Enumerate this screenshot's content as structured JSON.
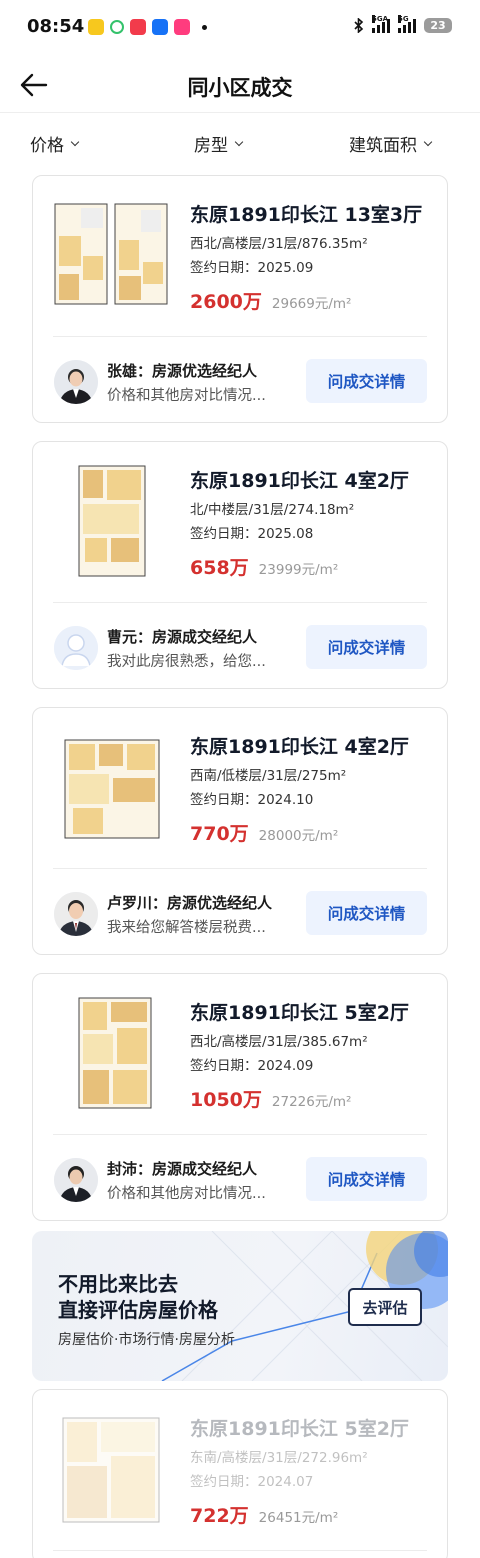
{
  "status_bar": {
    "time": "08:54",
    "app_icons": [
      {
        "name": "reading-app-icon",
        "color": "#f7c81e"
      },
      {
        "name": "refresh-app-icon",
        "color": "#34c26b"
      },
      {
        "name": "xiaohongshu-app-icon",
        "color": "#f23b4b"
      },
      {
        "name": "zhihu-app-icon",
        "color": "#1772f6"
      },
      {
        "name": "shopping-app-icon",
        "color": "#ff3c7e"
      }
    ],
    "network_1": "5GA",
    "network_2": "5G",
    "battery": "23"
  },
  "nav": {
    "title": "同小区成交"
  },
  "filters": [
    {
      "label": "价格"
    },
    {
      "label": "房型"
    },
    {
      "label": "建筑面积"
    }
  ],
  "listings": [
    {
      "title": "东原1891印长江 13室3厅",
      "meta": "西北/高楼层/31层/876.35m²",
      "date": "签约日期：2025.09",
      "price": "2600万",
      "unit_price": "29669元/m²",
      "agent": {
        "name": "张雄：房源优选经纪人",
        "message": "价格和其他房对比情况...",
        "avatar": "photo"
      },
      "button": "问成交详情"
    },
    {
      "title": "东原1891印长江 4室2厅",
      "meta": "北/中楼层/31层/274.18m²",
      "date": "签约日期：2025.08",
      "price": "658万",
      "unit_price": "23999元/m²",
      "agent": {
        "name": "曹元：房源成交经纪人",
        "message": "我对此房很熟悉，给您...",
        "avatar": "placeholder"
      },
      "button": "问成交详情"
    },
    {
      "title": "东原1891印长江 4室2厅",
      "meta": "西南/低楼层/31层/275m²",
      "date": "签约日期：2024.10",
      "price": "770万",
      "unit_price": "28000元/m²",
      "agent": {
        "name": "卢罗川：房源优选经纪人",
        "message": "我来给您解答楼层税费...",
        "avatar": "photo"
      },
      "button": "问成交详情"
    },
    {
      "title": "东原1891印长江 5室2厅",
      "meta": "西北/高楼层/31层/385.67m²",
      "date": "签约日期：2024.09",
      "price": "1050万",
      "unit_price": "27226元/m²",
      "agent": {
        "name": "封沛：房源成交经纪人",
        "message": "价格和其他房对比情况...",
        "avatar": "photo"
      },
      "button": "问成交详情"
    },
    {
      "title": "东原1891印长江 5室2厅",
      "meta": "东南/高楼层/31层/272.96m²",
      "date": "签约日期：2024.07",
      "price": "722万",
      "unit_price": "26451元/m²"
    }
  ],
  "banner": {
    "line1": "不用比来比去",
    "line2": "直接评估房屋价格",
    "subtitle": "房屋估价·市场行情·房屋分析",
    "button": "去评估"
  },
  "colors": {
    "price_red": "#d4312f",
    "button_blue": "#1f57c3",
    "button_bg": "#edf3fe",
    "title_navy": "#121a2a"
  }
}
